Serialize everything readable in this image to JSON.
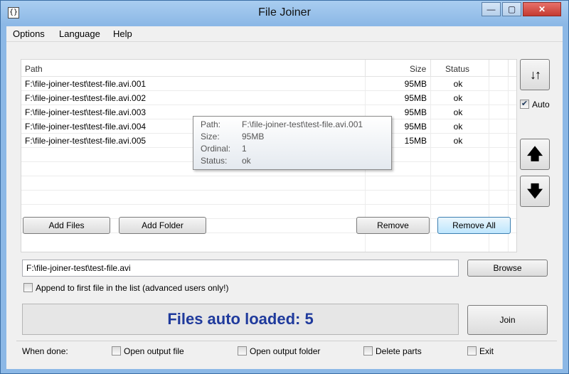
{
  "window": {
    "title": "File Joiner",
    "icon_glyph": "{}",
    "controls": {
      "minimize": "—",
      "maximize": "▢",
      "close": "✕"
    }
  },
  "menu": {
    "options": "Options",
    "language": "Language",
    "help": "Help"
  },
  "list": {
    "columns": {
      "path": "Path",
      "size": "Size",
      "status": "Status"
    },
    "rows": [
      {
        "path": "F:\\file-joiner-test\\test-file.avi.001",
        "size": "95MB",
        "status": "ok"
      },
      {
        "path": "F:\\file-joiner-test\\test-file.avi.002",
        "size": "95MB",
        "status": "ok"
      },
      {
        "path": "F:\\file-joiner-test\\test-file.avi.003",
        "size": "95MB",
        "status": "ok"
      },
      {
        "path": "F:\\file-joiner-test\\test-file.avi.004",
        "size": "95MB",
        "status": "ok"
      },
      {
        "path": "F:\\file-joiner-test\\test-file.avi.005",
        "size": "15MB",
        "status": "ok"
      }
    ]
  },
  "tooltip": {
    "path_label": "Path:",
    "path": "F:\\file-joiner-test\\test-file.avi.001",
    "size_label": "Size:",
    "size": "95MB",
    "ordinal_label": "Ordinal:",
    "ordinal": "1",
    "status_label": "Status:",
    "status": "ok"
  },
  "side": {
    "sort_icon": "↓↑",
    "auto_label": "Auto",
    "auto_checked": true,
    "up_icon": "🡅",
    "down_icon": "🡇"
  },
  "buttons": {
    "add_files": "Add Files",
    "add_folder": "Add Folder",
    "remove": "Remove",
    "remove_all": "Remove All",
    "browse": "Browse",
    "join": "Join"
  },
  "output": {
    "path": "F:\\file-joiner-test\\test-file.avi",
    "append_label": "Append to first file in the list (advanced users only!)",
    "append_checked": false
  },
  "status_message": "Files auto loaded: 5",
  "when_done": {
    "label": "When done:",
    "open_output_file": "Open output file",
    "open_output_folder": "Open output folder",
    "delete_parts": "Delete parts",
    "exit": "Exit"
  },
  "colors": {
    "status_text": "#1f3a9c",
    "title_bar": "#8cb8e6",
    "close_button": "#c43a31"
  }
}
